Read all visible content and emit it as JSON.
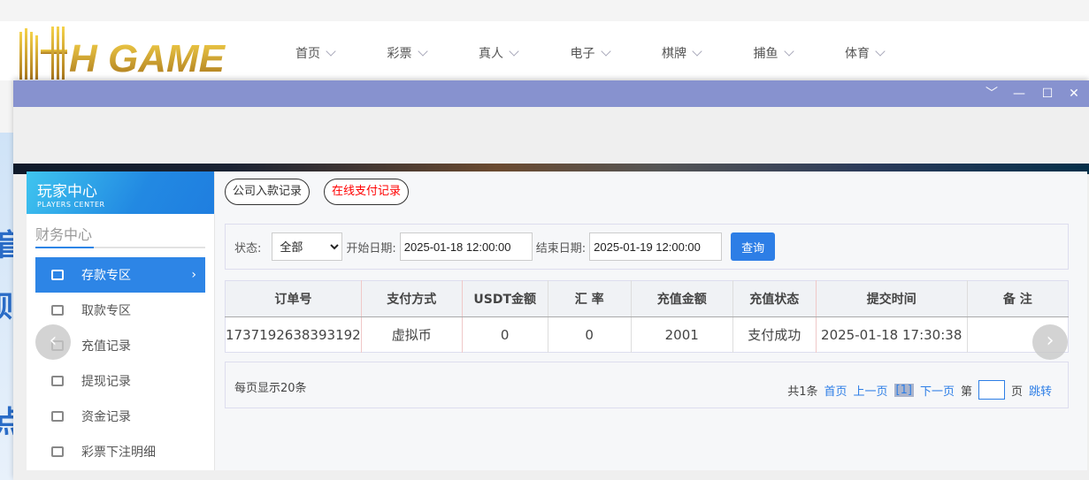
{
  "logo_text": "HH GAME",
  "nav": [
    "首页",
    "彩票",
    "真人",
    "电子",
    "棋牌",
    "捕鱼",
    "体育"
  ],
  "window_controls": [
    "chevron-down",
    "minimize",
    "maximize",
    "close"
  ],
  "sidebar": {
    "title": "玩家中心",
    "subtitle": "PLAYERS CENTER",
    "section": "财务中心",
    "items": [
      {
        "label": "存款专区",
        "icon": "card-icon",
        "active": true
      },
      {
        "label": "取款专区",
        "icon": "hand-money-icon"
      },
      {
        "label": "充值记录",
        "icon": "money-bag-icon"
      },
      {
        "label": "提现记录",
        "icon": "withdraw-icon"
      },
      {
        "label": "资金记录",
        "icon": "funds-icon"
      },
      {
        "label": "彩票下注明细",
        "icon": "list-icon"
      }
    ]
  },
  "tabs": [
    {
      "label": "公司入款记录"
    },
    {
      "label": "在线支付记录",
      "active": true
    }
  ],
  "filter": {
    "status_label": "状态:",
    "status_value": "全部",
    "start_label": "开始日期:",
    "start_value": "2025-01-18 12:00:00",
    "end_label": "结束日期:",
    "end_value": "2025-01-19 12:00:00",
    "query": "查询"
  },
  "table": {
    "headers": [
      "订单号",
      "支付方式",
      "USDT金额",
      "汇 率",
      "充值金额",
      "充值状态",
      "提交时间",
      "备 注"
    ],
    "rows": [
      [
        "1737192638393192",
        "虚拟币",
        "0",
        "0",
        "2001",
        "支付成功",
        "2025-01-18 17:30:38",
        ""
      ]
    ]
  },
  "pager": {
    "per_page": "每页显示20条",
    "total": "共1条",
    "first": "首页",
    "prev": "上一页",
    "current": "[1]",
    "next": "下一页",
    "page_prefix": "第",
    "page_suffix": "页",
    "jump": "跳转"
  },
  "colors": {
    "titlebar": "#8792cf",
    "accent": "#2d85e6",
    "active_tab": "#ff0000"
  }
}
